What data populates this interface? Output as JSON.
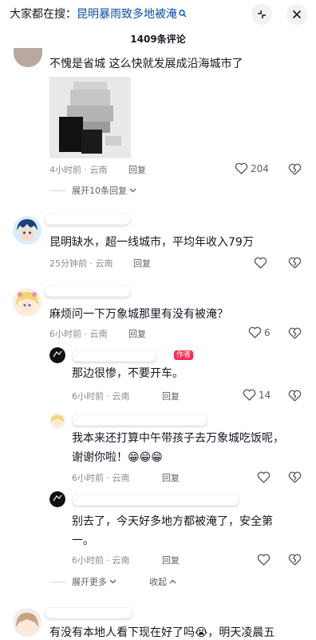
{
  "header": {
    "search_prefix": "大家都在搜：",
    "search_term": "昆明暴雨致多地被淹",
    "comment_count": "1409条评论"
  },
  "comments": [
    {
      "text": "不愧是省城 这么快就发展成沿海城市了",
      "time_location": "4小时前 · 云南",
      "reply_label": "回复",
      "likes": "204",
      "expand_label": "展开10条回复"
    },
    {
      "text": "昆明缺水，超一线城市，平均年收入79万",
      "time_location": "25分钟前 · 云南",
      "reply_label": "回复"
    },
    {
      "text": "麻烦问一下万象城那里有没有被淹？",
      "time_location": "6小时前 · 云南",
      "reply_label": "回复",
      "likes": "6"
    }
  ],
  "replies": [
    {
      "text": "那边很惨，不要开车。",
      "author_tag": "作者",
      "time_location": "6小时前 · 云南",
      "reply_label": "回复",
      "likes": "14"
    },
    {
      "text_line1": "我本来还打算中午带孩子去万象城吃饭呢，",
      "text_line2": "谢谢你啦！😁😁😁",
      "time_location": "6小时前 · 云南",
      "reply_label": "回复"
    },
    {
      "text_line1": "别去了，今天好多地方都被淹了，安全第",
      "text_line2": "一。",
      "time_location": "6小时前 · 云南",
      "reply_label": "回复"
    }
  ],
  "thread_controls": {
    "expand_more": "展开更多",
    "collapse": "收起"
  },
  "last_comment": {
    "text": "有没有本地人看下现在好了吗😭，明天凌晨五"
  },
  "colors": {
    "search_term": "#0a4fa6",
    "author_tag": "#fe2c55",
    "meta": "#8a8b91"
  }
}
